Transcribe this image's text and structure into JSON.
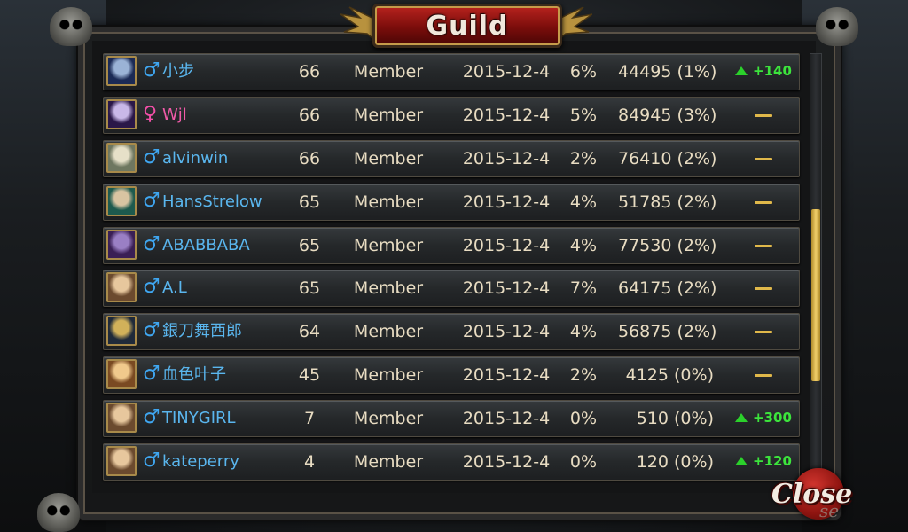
{
  "window": {
    "title": "Guild"
  },
  "members": [
    {
      "name": "小步",
      "gender": "male",
      "level": "66",
      "rank": "Member",
      "date": "2015-12-4",
      "pct": "6%",
      "contribution": "44495 (1%)",
      "trend": "+140",
      "avatar_colors": [
        "#1b2a55",
        "#9bb3d6"
      ]
    },
    {
      "name": "Wjl",
      "gender": "female",
      "level": "66",
      "rank": "Member",
      "date": "2015-12-4",
      "pct": "5%",
      "contribution": "84945 (3%)",
      "trend": "",
      "avatar_colors": [
        "#2a1748",
        "#c9b8e8"
      ]
    },
    {
      "name": "alvinwin",
      "gender": "male",
      "level": "66",
      "rank": "Member",
      "date": "2015-12-4",
      "pct": "2%",
      "contribution": "76410 (2%)",
      "trend": "",
      "avatar_colors": [
        "#6e7760",
        "#e6e0c8"
      ]
    },
    {
      "name": "HansStrelow",
      "gender": "male",
      "level": "65",
      "rank": "Member",
      "date": "2015-12-4",
      "pct": "4%",
      "contribution": "51785 (2%)",
      "trend": "",
      "avatar_colors": [
        "#1d5a4e",
        "#d9c4a2"
      ]
    },
    {
      "name": "ABABBABA",
      "gender": "male",
      "level": "65",
      "rank": "Member",
      "date": "2015-12-4",
      "pct": "4%",
      "contribution": "77530 (2%)",
      "trend": "",
      "avatar_colors": [
        "#3a1f55",
        "#9a7fc4"
      ]
    },
    {
      "name": "A.L",
      "gender": "male",
      "level": "65",
      "rank": "Member",
      "date": "2015-12-4",
      "pct": "7%",
      "contribution": "64175 (2%)",
      "trend": "",
      "avatar_colors": [
        "#6b4a2e",
        "#e7c79d"
      ]
    },
    {
      "name": "銀刀舞西郎",
      "gender": "male",
      "level": "64",
      "rank": "Member",
      "date": "2015-12-4",
      "pct": "4%",
      "contribution": "56875 (2%)",
      "trend": "",
      "avatar_colors": [
        "#1f2a3a",
        "#d1b15a"
      ]
    },
    {
      "name": "血色叶子",
      "gender": "male",
      "level": "45",
      "rank": "Member",
      "date": "2015-12-4",
      "pct": "2%",
      "contribution": "4125 (0%)",
      "trend": "",
      "avatar_colors": [
        "#7a4a22",
        "#f0c98c"
      ]
    },
    {
      "name": "TINYGIRL",
      "gender": "male",
      "level": "7",
      "rank": "Member",
      "date": "2015-12-4",
      "pct": "0%",
      "contribution": "510 (0%)",
      "trend": "+300",
      "avatar_colors": [
        "#6b4a2e",
        "#e7c79d"
      ]
    },
    {
      "name": "kateperry",
      "gender": "male",
      "level": "4",
      "rank": "Member",
      "date": "2015-12-4",
      "pct": "0%",
      "contribution": "120 (0%)",
      "trend": "+120",
      "avatar_colors": [
        "#6b4a2e",
        "#e7c79d"
      ]
    }
  ],
  "gender_symbols": {
    "male": "♂",
    "female": "♀"
  },
  "close_button": {
    "label": "Close",
    "shadow_label": "se"
  },
  "scroll": {
    "position_fraction": 0.6,
    "visible_fraction": 0.4
  },
  "colors": {
    "male": "#3fa6f0",
    "female": "#f24fa8",
    "trend_up": "#2bd12b",
    "trend_none": "#e0b84a",
    "title_plate": "#b8231e"
  }
}
